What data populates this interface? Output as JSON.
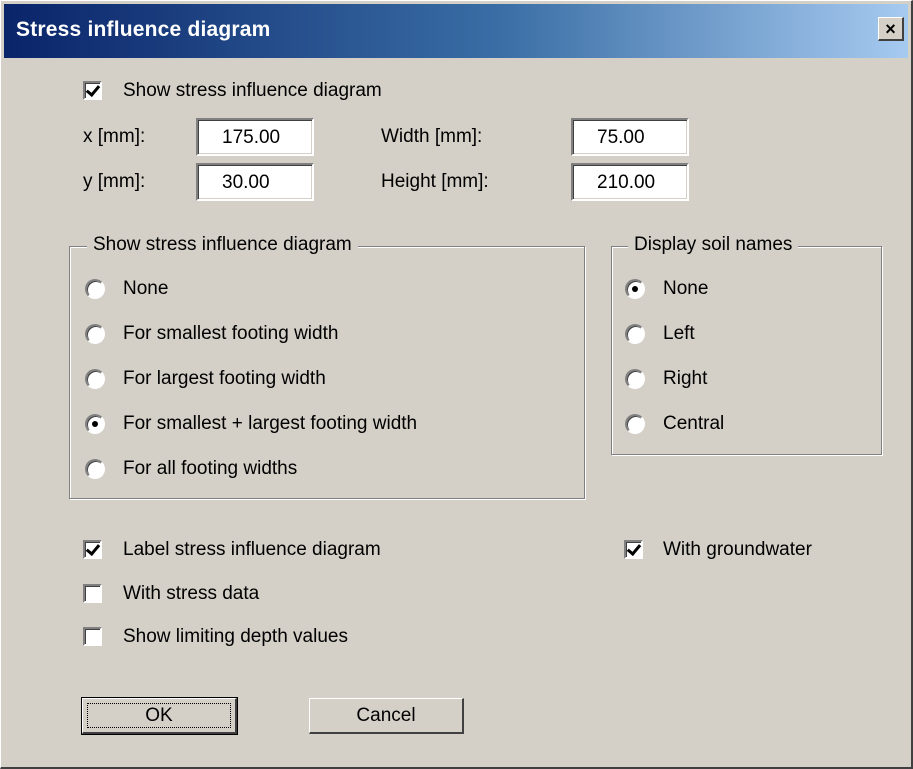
{
  "window": {
    "title": "Stress influence diagram",
    "close_label": "×"
  },
  "show_diagram": {
    "label": "Show stress influence diagram",
    "checked": true
  },
  "position": {
    "x_label": "x [mm]:",
    "x_value": "175.00",
    "y_label": "y [mm]:",
    "y_value": "30.00",
    "width_label": "Width [mm]:",
    "width_value": "75.00",
    "height_label": "Height [mm]:",
    "height_value": "210.00"
  },
  "diagram_group": {
    "title": "Show stress influence diagram",
    "options": [
      {
        "label": "None",
        "selected": false
      },
      {
        "label": "For smallest footing width",
        "selected": false
      },
      {
        "label": "For largest footing width",
        "selected": false
      },
      {
        "label": "For smallest + largest footing width",
        "selected": true
      },
      {
        "label": "For all footing widths",
        "selected": false
      }
    ]
  },
  "soil_group": {
    "title": "Display soil names",
    "options": [
      {
        "label": "None",
        "selected": true
      },
      {
        "label": "Left",
        "selected": false
      },
      {
        "label": "Right",
        "selected": false
      },
      {
        "label": "Central",
        "selected": false
      }
    ]
  },
  "checkboxes": {
    "label_diagram": {
      "label": "Label stress influence diagram",
      "checked": true
    },
    "with_groundwater": {
      "label": "With groundwater",
      "checked": true
    },
    "with_stress_data": {
      "label": "With stress data",
      "checked": false
    },
    "show_limiting_depth": {
      "label": "Show limiting depth values",
      "checked": false
    }
  },
  "buttons": {
    "ok": "OK",
    "cancel": "Cancel"
  }
}
